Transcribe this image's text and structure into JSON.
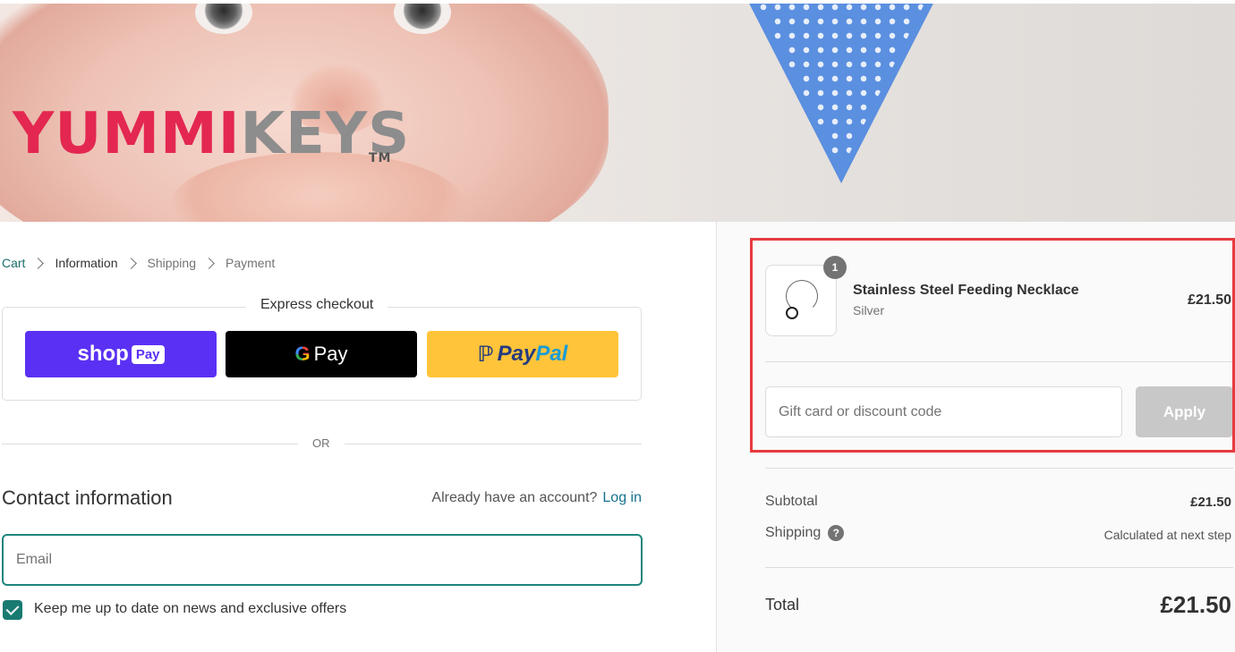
{
  "banner": {
    "logo_part1": "YUMMI",
    "logo_part2": "KEYS",
    "logo_tm": "TM"
  },
  "breadcrumb": {
    "items": [
      {
        "label": "Cart"
      },
      {
        "label": "Information"
      },
      {
        "label": "Shipping"
      },
      {
        "label": "Payment"
      }
    ]
  },
  "express": {
    "title": "Express checkout",
    "shoppay_label": "shop",
    "shoppay_badge": "Pay",
    "gpay_g": "G",
    "gpay_label": "Pay",
    "paypal_part1": "Pay",
    "paypal_part2": "Pal"
  },
  "divider_or": "OR",
  "contact": {
    "title": "Contact information",
    "account_prompt": "Already have an account?",
    "login_label": "Log in",
    "email_placeholder": "Email",
    "newsletter_label": "Keep me up to date on news and exclusive offers"
  },
  "summary": {
    "product": {
      "quantity": "1",
      "name": "Stainless Steel Feeding Necklace",
      "variant": "Silver",
      "price": "£21.50"
    },
    "discount_placeholder": "Gift card or discount code",
    "apply_label": "Apply",
    "subtotal_label": "Subtotal",
    "subtotal_value": "£21.50",
    "shipping_label": "Shipping",
    "shipping_value": "Calculated at next step",
    "total_label": "Total",
    "total_value": "£21.50"
  },
  "colors": {
    "accent": "#1f857d",
    "shop_pay": "#5a31f4",
    "paypal": "#ffc439",
    "highlight": "#e63b3f"
  }
}
